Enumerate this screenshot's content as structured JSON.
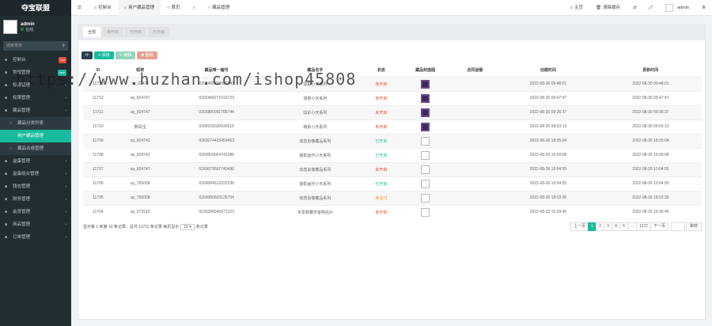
{
  "sidebar": {
    "logo": "夺宝联盟",
    "user_name": "admin",
    "status": "在线",
    "search_placeholder": "搜索菜单",
    "items": [
      {
        "label": "控制台",
        "badge": "hot",
        "badge_color": "#e74c3c"
      },
      {
        "label": "常规管理",
        "badge": "new",
        "badge_color": "#18bc9c"
      },
      {
        "label": "权限管理",
        "badge": "",
        "badge_color": ""
      },
      {
        "label": "权限管理",
        "badge": "",
        "badge_color": ""
      },
      {
        "label": "藏品管理",
        "badge": "",
        "badge_color": ""
      }
    ],
    "sub_items": [
      {
        "label": "藏品分类列表"
      },
      {
        "label": "用户藏品管理"
      },
      {
        "label": "藏品合成管理"
      }
    ],
    "items2": [
      {
        "label": "盒蛋管理"
      },
      {
        "label": "盒蛋组合管理"
      },
      {
        "label": "钱包管理"
      },
      {
        "label": "财务管理"
      },
      {
        "label": "会员管理"
      },
      {
        "label": "商品管理"
      },
      {
        "label": "订单管理"
      }
    ]
  },
  "topbar": {
    "tabs": [
      "控制台",
      "用户藏品管理",
      "首页",
      ""
    ],
    "tab4": "藏品管理",
    "right": [
      "主页",
      "清除缓存"
    ],
    "admin": "admin"
  },
  "panel": {
    "tabs": [
      "全部",
      "未开启",
      "已开启",
      "已开启"
    ],
    "toolbar": {
      "add": "添加",
      "edit": "编辑",
      "del": "删除"
    },
    "columns": [
      "ID",
      "昵称",
      "藏品唯一编号",
      "藏品名字",
      "状态",
      "藏品封面图",
      "合同金额",
      "创建时间",
      "更新时间"
    ],
    "rows": [
      {
        "id": "11713",
        "nick": "sp_02472",
        "code": "0302468169002243",
        "name": "炫彩小天系列",
        "status": "未开启",
        "status_class": "st-red",
        "thumb": "dark",
        "amount": "",
        "created": "2022-08-30 09:48:01",
        "updated": "2022-08-30 09:48:01"
      },
      {
        "id": "11712",
        "nick": "sp_824747",
        "code": "0302468271016723",
        "name": "漫卷小天系列",
        "status": "未开启",
        "status_class": "st-red",
        "thumb": "dark",
        "amount": "",
        "created": "2022-08-30 09:47:47",
        "updated": "2022-08-30 09:47:47"
      },
      {
        "id": "11711",
        "nick": "sp_824747",
        "code": "0303880091786744",
        "name": "炫彩小天系列",
        "status": "未开启",
        "status_class": "st-red",
        "thumb": "dark",
        "amount": "",
        "created": "2022-08-30 09:36:37",
        "updated": "2022-08-30 09:36:37"
      },
      {
        "id": "11710",
        "nick": "数码宝",
        "code": "0309159030030610",
        "name": "萌系小天系列",
        "status": "未开启",
        "status_class": "st-red",
        "thumb": "dark",
        "amount": "",
        "created": "2022-08-30 09:03:13",
        "updated": "2022-08-30 09:03:13"
      },
      {
        "id": "11709",
        "nick": "sp_824742",
        "code": "0260074433453453",
        "name": "动态肖像藏品系列",
        "status": "已开启",
        "status_class": "st-green",
        "thumb": "blank",
        "amount": "",
        "created": "2022-08-26 18:35:04",
        "updated": "2022-08-26 18:35:04"
      },
      {
        "id": "11708",
        "nick": "sp_824742",
        "code": "0260009064742386",
        "name": "摄影画作小天系列",
        "status": "已开启",
        "status_class": "st-green",
        "thumb": "blank",
        "amount": "",
        "created": "2022-08-26 10:09:08",
        "updated": "2022-08-26 10:09:08"
      },
      {
        "id": "11707",
        "nick": "sp_824747",
        "code": "0260079567740490",
        "name": "动态肖像藏品系列",
        "status": "未开启",
        "status_class": "st-red",
        "thumb": "blank",
        "amount": "",
        "created": "2022-08-26 10:04:55",
        "updated": "2022-08-26 10:04:55"
      },
      {
        "id": "11706",
        "nick": "sp_765008",
        "code": "0260084513222530",
        "name": "摄影画作小天系列",
        "status": "已开启",
        "status_class": "st-green",
        "thumb": "blank",
        "amount": "",
        "created": "2022-08-26 10:04:05",
        "updated": "2022-08-26 10:04:05"
      },
      {
        "id": "11705",
        "nick": "sp_765008",
        "code": "0260080603126704",
        "name": "动态肖像藏品系列",
        "status": "未支付",
        "status_class": "st-org",
        "thumb": "blank",
        "amount": "",
        "created": "2022-08-26 18:03:36",
        "updated": "2022-08-26 18:03:36"
      },
      {
        "id": "11704",
        "nick": "sp_972515",
        "code": "0225396545671323",
        "name": "专享数藏宇宙明信片",
        "status": "未开启",
        "status_class": "st-red",
        "thumb": "blank",
        "amount": "",
        "created": "2022-08-22 15:39:46",
        "updated": "2022-08-22 15:39:46"
      }
    ],
    "footer": {
      "info": "显示第 1 到第 10 条记录，总共 11711 条记录 每页显示",
      "per_page": "10",
      "suffix": "条记录"
    },
    "pager": {
      "prev": "上一页",
      "pages": [
        "1",
        "2",
        "3",
        "4",
        "5"
      ],
      "ellipsis": "...",
      "last": "1172",
      "next": "下一页",
      "go": "跳转"
    }
  },
  "watermark": "https://www.huzhan.com/ishop45808"
}
